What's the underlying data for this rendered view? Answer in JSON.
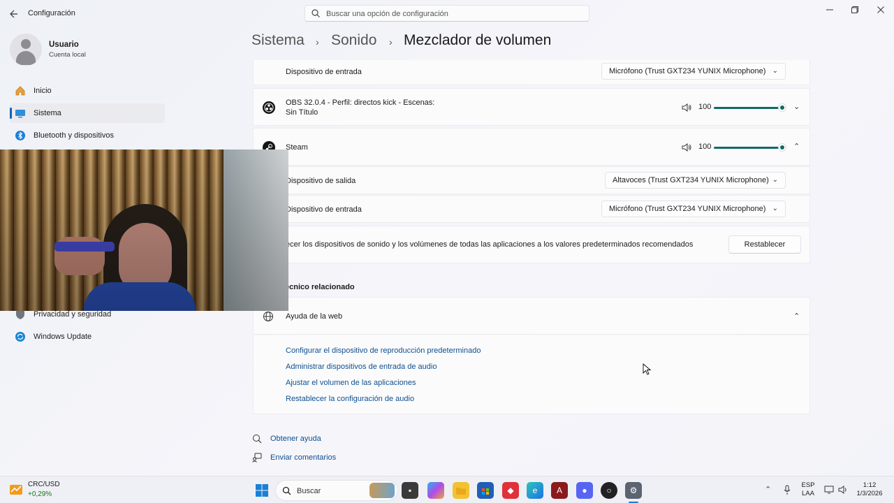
{
  "window": {
    "title": "Configuración",
    "search_placeholder": "Buscar una opción de configuración"
  },
  "user": {
    "name": "Usuario",
    "account": "Cuenta local"
  },
  "sidebar": {
    "items": [
      {
        "label": "Inicio",
        "icon": "home-icon"
      },
      {
        "label": "Sistema",
        "icon": "system-icon",
        "active": true
      },
      {
        "label": "Bluetooth y dispositivos",
        "icon": "bluetooth-icon"
      },
      {
        "label": "Privacidad y seguridad",
        "icon": "shield-icon"
      },
      {
        "label": "Windows Update",
        "icon": "update-icon"
      }
    ]
  },
  "breadcrumb": {
    "level1": "Sistema",
    "level2": "Sonido",
    "current": "Mezclador de volumen"
  },
  "mixer": {
    "top_input_label": "Dispositivo de entrada",
    "top_input_value": "Micrófono (Trust GXT234 YUNIX Microphone)",
    "obs": {
      "name_line1": "OBS 32.0.4 - Perfil: directos kick - Escenas:",
      "name_line2": "Sin Título",
      "volume": "100",
      "volume_level": 100
    },
    "steam": {
      "name": "Steam",
      "volume": "100",
      "volume_level": 100
    },
    "steam_output_label": "Dispositivo de salida",
    "steam_output_value": "Altavoces (Trust GXT234 YUNIX Microphone)",
    "steam_input_label": "Dispositivo de entrada",
    "steam_input_value": "Micrófono (Trust GXT234 YUNIX Microphone)",
    "reset_text": "ecer los dispositivos de sonido y los volúmenes de todas las aplicaciones a los valores predeterminados recomendados",
    "reset_button": "Restablecer"
  },
  "related": {
    "title": "écnico relacionado",
    "web_help": "Ayuda de la web",
    "links": [
      "Configurar el dispositivo de reproducción predeterminado",
      "Administrar dispositivos de entrada de audio",
      "Ajustar el volumen de las aplicaciones",
      "Restablecer la configuración de audio"
    ]
  },
  "footer": {
    "get_help": "Obtener ayuda",
    "feedback": "Enviar comentarios"
  },
  "taskbar": {
    "stock_name": "CRC/USD",
    "stock_change": "+0,29%",
    "search_label": "Buscar",
    "lang_line1": "ESP",
    "lang_line2": "LAA",
    "time": "1:12",
    "date": "1/3/2026"
  },
  "colors": {
    "accent": "#0067c0",
    "slider": "#0f6b66",
    "link": "#0e4f8f"
  }
}
